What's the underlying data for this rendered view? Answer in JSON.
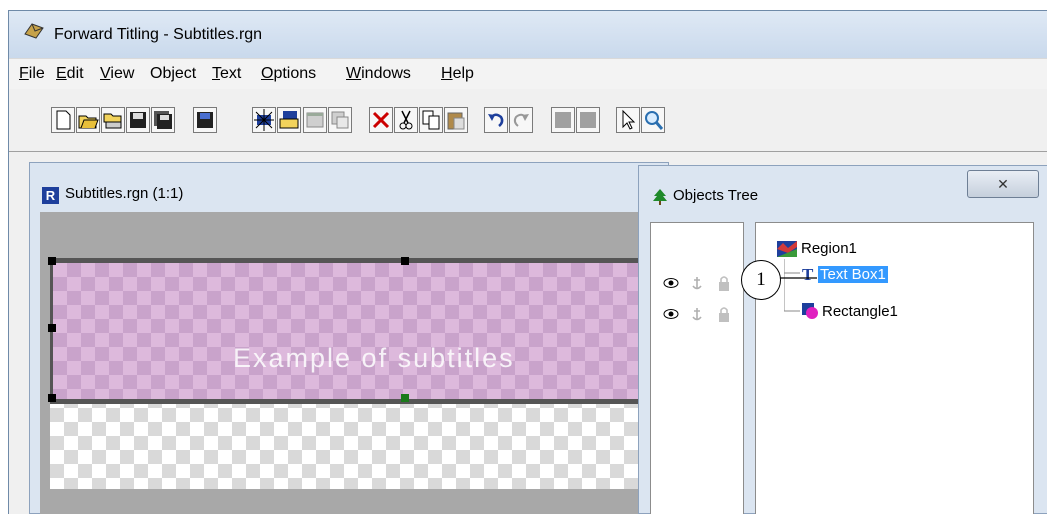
{
  "window": {
    "title": "Forward Titling - Subtitles.rgn"
  },
  "menu": [
    {
      "accel": "F",
      "rest": "ile"
    },
    {
      "accel": "E",
      "rest": "dit"
    },
    {
      "accel": "V",
      "rest": "iew"
    },
    {
      "accel": "",
      "rest": "Object"
    },
    {
      "accel": "T",
      "rest": "ext"
    },
    {
      "accel": "O",
      "rest": "ptions"
    },
    {
      "accel": "W",
      "rest": "indows"
    },
    {
      "accel": "H",
      "rest": "elp"
    }
  ],
  "document": {
    "title": "Subtitles.rgn  (1:1)",
    "badge": "R",
    "subtitle_text": "Example of subtitles"
  },
  "objects_tree": {
    "title": "Objects Tree",
    "close_label": "✕",
    "nodes": [
      {
        "label": "Region1",
        "icon": "region-icon"
      },
      {
        "label": "Text Box1",
        "icon": "text-icon",
        "selected": true
      },
      {
        "label": "Rectangle1",
        "icon": "shape-icon"
      }
    ]
  },
  "callout": {
    "number": "1"
  },
  "colors": {
    "selection": "#3399ff",
    "subtitle_box": "#ddb9dc",
    "delete": "#cc0000"
  }
}
